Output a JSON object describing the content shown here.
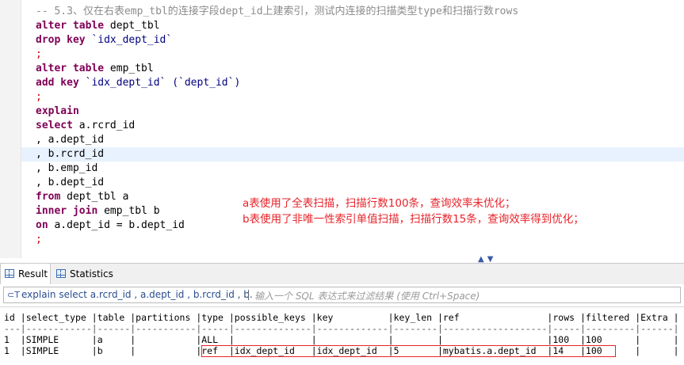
{
  "editor": {
    "comment": "-- 5.3、仅在右表emp_tbl的连接字段dept_id上建索引，测试内连接的扫描类型type和扫描行数rows",
    "lines": [
      {
        "kw": "alter table",
        "rest": " dept_tbl"
      },
      {
        "kw": "drop key",
        "rest": " `idx_dept_id`"
      },
      {
        "semi": ";"
      },
      {
        "kw": "alter table",
        "rest": " emp_tbl"
      },
      {
        "kw": "add key",
        "rest": " `idx_dept_id` (`dept_id`)"
      },
      {
        "semi": ";"
      },
      {
        "kw": "explain",
        "rest": ""
      },
      {
        "kw": "select",
        "rest": " a.rcrd_id"
      },
      {
        "kw": "",
        "rest": ", a.dept_id"
      },
      {
        "kw": "",
        "rest": ", b.rcrd_id"
      },
      {
        "kw": "",
        "rest": ", b.emp_id"
      },
      {
        "kw": "",
        "rest": ", b.dept_id"
      },
      {
        "kw": "from",
        "rest": " dept_tbl a"
      },
      {
        "kw": "inner join",
        "rest": " emp_tbl b"
      },
      {
        "kw": "on",
        "rest": " a.dept_id = b.dept_id"
      },
      {
        "semi": ";"
      }
    ],
    "notes": [
      "a表使用了全表扫描，扫描行数100条，查询效率未优化；",
      "b表使用了非唯一性索引单值扫描，扫描行数15条，查询效率得到优化；"
    ],
    "scroll_arrows": "▲▼"
  },
  "tabs": [
    {
      "label": "Result",
      "icon": "grid-icon",
      "active": true
    },
    {
      "label": "Statistics",
      "icon": "grid-icon",
      "active": false
    }
  ],
  "filter": {
    "icon": "filter-icon",
    "query": "explain select a.rcrd_id , a.dept_id , b.rcrd_id , b.",
    "placeholder": "输入一个 SQL 表达式来过滤结果 (使用 Ctrl+Space)"
  },
  "result": {
    "header_line": "id |select_type |table |partitions |type |possible_keys |key          |key_len |ref                |rows |filtered |Extra |",
    "sep_line": "---|------------|------|-----------|-----|--------------|-------------|--------|-------------------|-----|---------|------|",
    "rows": [
      "1  |SIMPLE      |a     |           |ALL  |              |             |        |                   |100  |100      |      |",
      "1  |SIMPLE      |b     |           |ref  |idx_dept_id   |idx_dept_id  |5       |mybatis.a.dept_id  |14   |100      |      |"
    ],
    "highlight_color": "#e8232a"
  }
}
